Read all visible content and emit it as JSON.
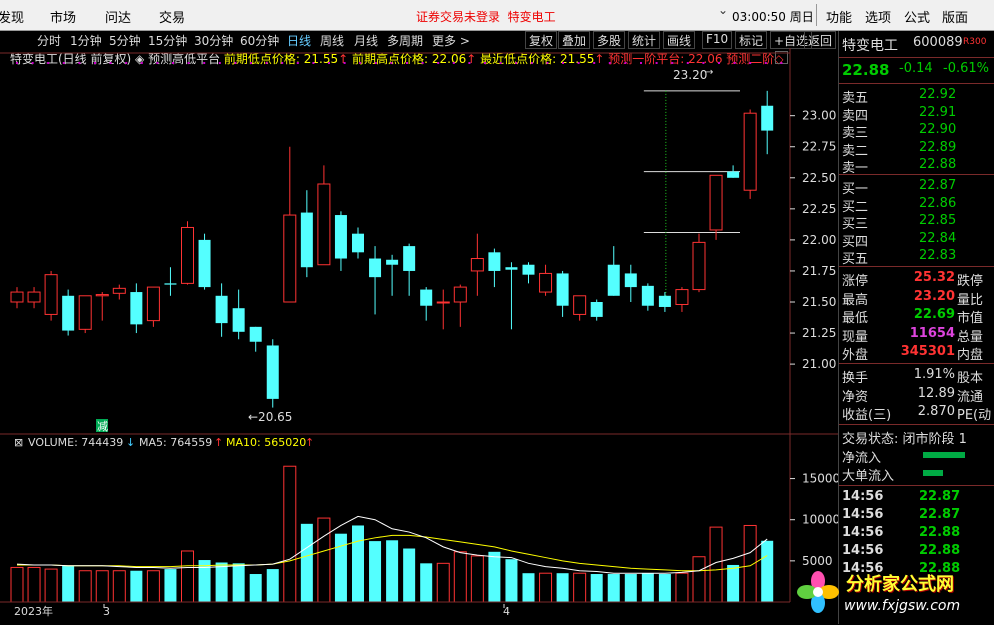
{
  "menu": {
    "items": [
      "发现",
      "市场",
      "问达",
      "交易"
    ],
    "notice_prefix": "证券交易未登录",
    "notice_stock": "特变电工",
    "clock": "03:00:50 周日",
    "right_items": [
      "功能",
      "选项",
      "公式",
      "版面"
    ]
  },
  "toolbar": {
    "periods": [
      "分时",
      "1分钟",
      "5分钟",
      "15分钟",
      "30分钟",
      "60分钟",
      "日线",
      "周线",
      "月线",
      "多周期",
      "更多 >"
    ],
    "active": "日线",
    "right_buttons": [
      "复权",
      "叠加",
      "多股",
      "统计",
      "画线",
      "F10",
      "标记",
      "+自选",
      "返回"
    ]
  },
  "chart_header": {
    "title": "特变电工(日线 前复权)",
    "indicator": "预测高低平台",
    "items": [
      {
        "label": "前期低点价格: 21.55",
        "color": "#ffff00"
      },
      {
        "label": "前期高点价格: 22.06",
        "color": "#ffff00"
      },
      {
        "label": "最近低点价格: 21.55",
        "color": "#ffff00"
      },
      {
        "label": "预测一阶平台: 22.06",
        "color": "#ff3333"
      },
      {
        "label": "预测二阶◇",
        "color": "#ff3333"
      }
    ]
  },
  "volume_header": {
    "volume": "VOLUME: 744439",
    "ma5": "MA5: 764559",
    "ma10": "MA10: 565020"
  },
  "annotations": {
    "high_label": "23.20",
    "low_label": "←20.65",
    "jian": "减"
  },
  "xaxis": {
    "year": "2023年",
    "m3": "3",
    "m4": "4"
  },
  "colors": {
    "up": "#ff3333",
    "down": "#54ffff",
    "ma5": "#ffffff",
    "ma10": "#ffff00",
    "grid": "#7a2a2a"
  },
  "quote": {
    "name": "特变电工",
    "code": "600089",
    "badge": "R300",
    "price": "22.88",
    "change": "-0.14",
    "pct": "-0.61%",
    "asks": [
      {
        "label": "卖五",
        "price": "22.92"
      },
      {
        "label": "卖四",
        "price": "22.91"
      },
      {
        "label": "卖三",
        "price": "22.90"
      },
      {
        "label": "卖二",
        "price": "22.89"
      },
      {
        "label": "卖一",
        "price": "22.88"
      }
    ],
    "bids": [
      {
        "label": "买一",
        "price": "22.87"
      },
      {
        "label": "买二",
        "price": "22.86"
      },
      {
        "label": "买三",
        "price": "22.85"
      },
      {
        "label": "买四",
        "price": "22.84"
      },
      {
        "label": "买五",
        "price": "22.83"
      }
    ],
    "stats": [
      {
        "label": "涨停",
        "value": "25.32",
        "color": "#ff3333",
        "extra": "跌停"
      },
      {
        "label": "最高",
        "value": "23.20",
        "color": "#ff3333",
        "extra": "量比"
      },
      {
        "label": "最低",
        "value": "22.69",
        "color": "#00cc00",
        "extra": "市值"
      },
      {
        "label": "现量",
        "value": "11654",
        "color": "#dd44dd",
        "extra": "总量"
      },
      {
        "label": "外盘",
        "value": "345301",
        "color": "#ff3333",
        "extra": "内盘"
      }
    ],
    "stats2": [
      {
        "label": "换手",
        "value": "1.91%",
        "extra": "股本"
      },
      {
        "label": "净资",
        "value": "12.89",
        "extra": "流通"
      },
      {
        "label": "收益(三)",
        "value": "2.870",
        "extra": "PE(动"
      }
    ],
    "trade_status": "交易状态: 闭市阶段 1",
    "flows": [
      {
        "label": "净流入"
      },
      {
        "label": "大单流入"
      }
    ],
    "ticks": [
      {
        "time": "14:56",
        "price": "22.87"
      },
      {
        "time": "14:56",
        "price": "22.87"
      },
      {
        "time": "14:56",
        "price": "22.88"
      },
      {
        "time": "14:56",
        "price": "22.88"
      },
      {
        "time": "14:56",
        "price": "22.88"
      }
    ]
  },
  "watermark": {
    "title": "分析家公式网",
    "url": "www.fxjgsw.com"
  },
  "chart_data": {
    "type": "candlestick",
    "y_ticks": [
      "23.00",
      "22.75",
      "22.50",
      "22.25",
      "22.00",
      "21.75",
      "21.50",
      "21.25",
      "21.00"
    ],
    "ylim": [
      20.55,
      23.4
    ],
    "candles": [
      {
        "o": 21.5,
        "h": 21.62,
        "l": 21.45,
        "c": 21.58
      },
      {
        "o": 21.5,
        "h": 21.62,
        "l": 21.45,
        "c": 21.58
      },
      {
        "o": 21.4,
        "h": 21.75,
        "l": 21.35,
        "c": 21.72
      },
      {
        "o": 21.55,
        "h": 21.6,
        "l": 21.23,
        "c": 21.27
      },
      {
        "o": 21.28,
        "h": 21.55,
        "l": 21.25,
        "c": 21.55
      },
      {
        "o": 21.55,
        "h": 21.58,
        "l": 21.35,
        "c": 21.56
      },
      {
        "o": 21.57,
        "h": 21.64,
        "l": 21.52,
        "c": 21.61
      },
      {
        "o": 21.58,
        "h": 21.65,
        "l": 21.25,
        "c": 21.32
      },
      {
        "o": 21.35,
        "h": 21.62,
        "l": 21.3,
        "c": 21.62
      },
      {
        "o": 21.65,
        "h": 21.78,
        "l": 21.55,
        "c": 21.64
      },
      {
        "o": 21.65,
        "h": 22.15,
        "l": 21.64,
        "c": 22.1
      },
      {
        "o": 22.0,
        "h": 22.05,
        "l": 21.6,
        "c": 21.62
      },
      {
        "o": 21.55,
        "h": 21.65,
        "l": 21.22,
        "c": 21.33
      },
      {
        "o": 21.45,
        "h": 21.6,
        "l": 21.2,
        "c": 21.26
      },
      {
        "o": 21.3,
        "h": 21.3,
        "l": 21.1,
        "c": 21.18
      },
      {
        "o": 21.15,
        "h": 21.2,
        "l": 20.65,
        "c": 20.72
      },
      {
        "o": 21.5,
        "h": 22.75,
        "l": 21.5,
        "c": 22.2
      },
      {
        "o": 22.22,
        "h": 22.4,
        "l": 21.7,
        "c": 21.78
      },
      {
        "o": 21.8,
        "h": 22.6,
        "l": 21.8,
        "c": 22.45
      },
      {
        "o": 22.2,
        "h": 22.23,
        "l": 21.75,
        "c": 21.85
      },
      {
        "o": 22.05,
        "h": 22.1,
        "l": 21.85,
        "c": 21.9
      },
      {
        "o": 21.85,
        "h": 21.95,
        "l": 21.4,
        "c": 21.7
      },
      {
        "o": 21.84,
        "h": 21.88,
        "l": 21.55,
        "c": 21.8
      },
      {
        "o": 21.95,
        "h": 21.97,
        "l": 21.55,
        "c": 21.75
      },
      {
        "o": 21.6,
        "h": 21.62,
        "l": 21.35,
        "c": 21.47
      },
      {
        "o": 21.5,
        "h": 21.6,
        "l": 21.28,
        "c": 21.5
      },
      {
        "o": 21.5,
        "h": 21.64,
        "l": 21.3,
        "c": 21.62
      },
      {
        "o": 21.75,
        "h": 22.05,
        "l": 21.55,
        "c": 21.85
      },
      {
        "o": 21.9,
        "h": 21.93,
        "l": 21.62,
        "c": 21.75
      },
      {
        "o": 21.78,
        "h": 21.82,
        "l": 21.28,
        "c": 21.76
      },
      {
        "o": 21.8,
        "h": 21.82,
        "l": 21.65,
        "c": 21.72
      },
      {
        "o": 21.58,
        "h": 21.8,
        "l": 21.55,
        "c": 21.73
      },
      {
        "o": 21.73,
        "h": 21.75,
        "l": 21.38,
        "c": 21.47
      },
      {
        "o": 21.4,
        "h": 21.55,
        "l": 21.35,
        "c": 21.55
      },
      {
        "o": 21.5,
        "h": 21.52,
        "l": 21.35,
        "c": 21.38
      },
      {
        "o": 21.8,
        "h": 21.95,
        "l": 21.55,
        "c": 21.55
      },
      {
        "o": 21.73,
        "h": 21.8,
        "l": 21.5,
        "c": 21.62
      },
      {
        "o": 21.63,
        "h": 21.65,
        "l": 21.43,
        "c": 21.47
      },
      {
        "o": 21.55,
        "h": 21.58,
        "l": 21.42,
        "c": 21.46
      },
      {
        "o": 21.48,
        "h": 21.62,
        "l": 21.42,
        "c": 21.6
      },
      {
        "o": 21.6,
        "h": 22.05,
        "l": 21.58,
        "c": 21.98
      },
      {
        "o": 22.08,
        "h": 22.52,
        "l": 22.0,
        "c": 22.52
      },
      {
        "o": 22.55,
        "h": 22.6,
        "l": 22.5,
        "c": 22.5
      },
      {
        "o": 22.4,
        "h": 23.05,
        "l": 22.33,
        "c": 23.02
      },
      {
        "o": 23.08,
        "h": 23.2,
        "l": 22.69,
        "c": 22.88
      }
    ],
    "volume_ticks": [
      "15000",
      "10000",
      "5000"
    ],
    "volume_max": 17500,
    "volume": [
      4200,
      4200,
      4000,
      4400,
      3800,
      3800,
      3800,
      3800,
      3800,
      4000,
      6200,
      5100,
      4800,
      4700,
      3400,
      4000,
      16500,
      9500,
      10200,
      8300,
      9300,
      7400,
      7500,
      6500,
      4700,
      4700,
      6100,
      5600,
      6100,
      5200,
      3500,
      3500,
      3500,
      3500,
      3400,
      3400,
      3400,
      3500,
      3400,
      3500,
      5500,
      9100,
      4500,
      9300,
      7440
    ],
    "ma5": [
      4600,
      4500,
      4500,
      4400,
      4400,
      4400,
      4300,
      4200,
      4200,
      4100,
      4200,
      4200,
      4300,
      4400,
      4500,
      4600,
      5200,
      6600,
      8000,
      9300,
      10400,
      10000,
      8900,
      8500,
      7800,
      6700,
      6000,
      5700,
      5500,
      5400,
      4700,
      4300,
      4100,
      3800,
      3700,
      3500,
      3500,
      3500,
      3500,
      3600,
      3800,
      4800,
      5300,
      6000,
      7650
    ],
    "ma10": [
      4500,
      4500,
      4500,
      4400,
      4400,
      4400,
      4400,
      4300,
      4300,
      4300,
      4400,
      4400,
      4500,
      4500,
      4500,
      4600,
      5000,
      5600,
      6200,
      6800,
      7400,
      7800,
      8100,
      8100,
      7900,
      7600,
      7300,
      7000,
      6700,
      6200,
      5800,
      5400,
      5000,
      4700,
      4500,
      4300,
      4100,
      4000,
      3900,
      3800,
      3800,
      3900,
      4100,
      4400,
      5650
    ],
    "levels": [
      {
        "price": 23.2,
        "from": 37
      },
      {
        "price": 22.55,
        "from": 37
      },
      {
        "price": 22.06,
        "from": 37
      }
    ]
  }
}
